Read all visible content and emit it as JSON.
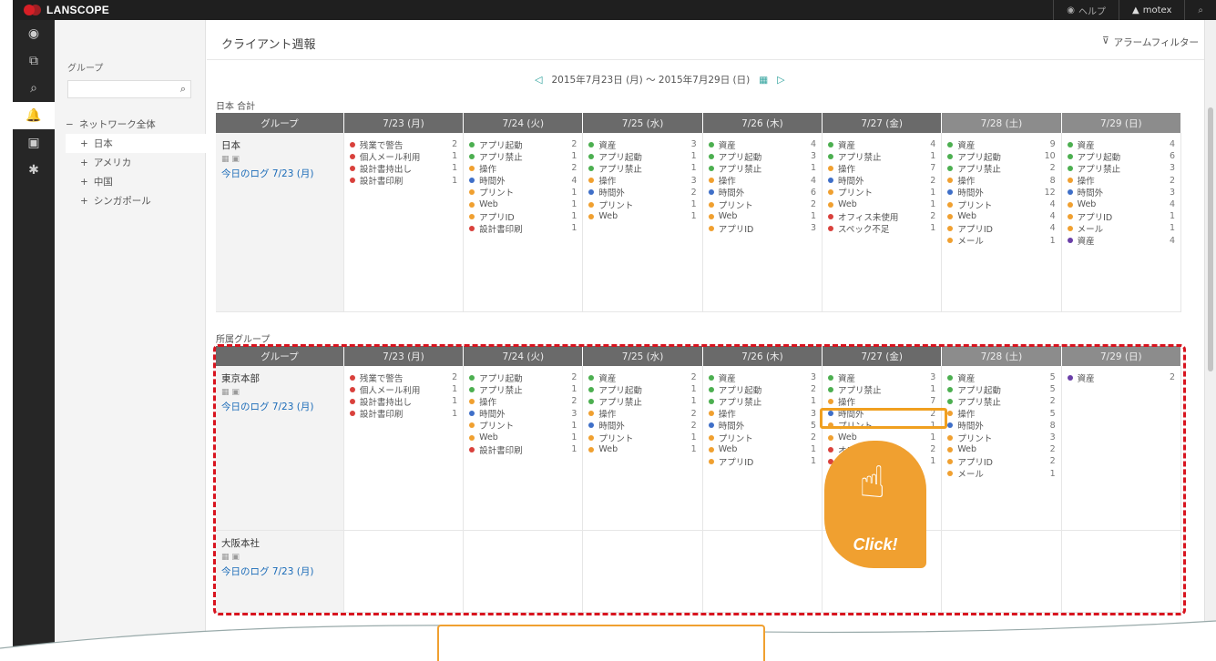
{
  "app": {
    "logo_text": "LANSCOPE"
  },
  "topbar": {
    "help_label": "ヘルプ",
    "user_label": "motex"
  },
  "nav": {
    "items": [
      {
        "icon": "dashboard-icon",
        "glyph": "◉"
      },
      {
        "icon": "devices-icon",
        "glyph": "⧉"
      },
      {
        "icon": "search-icon",
        "glyph": "⌕"
      },
      {
        "icon": "bell-icon",
        "glyph": "🔔",
        "active": true
      },
      {
        "icon": "report-icon",
        "glyph": "▣"
      },
      {
        "icon": "gear-icon",
        "glyph": "✱"
      }
    ]
  },
  "groups_panel": {
    "title": "グループ",
    "search_placeholder": "",
    "tree": [
      {
        "label": "ネットワーク全体",
        "prefix": "−",
        "level": 0
      },
      {
        "label": "日本",
        "prefix": "+",
        "level": 1,
        "selected": true
      },
      {
        "label": "アメリカ",
        "prefix": "+",
        "level": 1
      },
      {
        "label": "中国",
        "prefix": "+",
        "level": 1
      },
      {
        "label": "シンガポール",
        "prefix": "+",
        "level": 1
      }
    ]
  },
  "page": {
    "title": "クライアント週報",
    "alarm_filter_label": "アラームフィルター",
    "date_range": "2015年7月23日 (月) ～ 2015年7月29日 (日)"
  },
  "days": [
    "7/23 (月)",
    "7/24 (火)",
    "7/25 (水)",
    "7/26 (木)",
    "7/27 (金)",
    "7/28 (土)",
    "7/29 (日)"
  ],
  "group_header": "グループ",
  "section1": {
    "label": "日本 合計",
    "rows": [
      {
        "name": "日本",
        "log_label": "今日のログ",
        "log_date": "7/23 (月)",
        "days": [
          [
            {
              "c": "#d9413c",
              "t": "残業で警告",
              "n": "2"
            },
            {
              "c": "#d9413c",
              "t": "個人メール利用",
              "n": "1"
            },
            {
              "c": "#d9413c",
              "t": "設計書持出し",
              "n": "1"
            },
            {
              "c": "#d9413c",
              "t": "設計書印刷",
              "n": "1"
            }
          ],
          [
            {
              "c": "#4caf50",
              "t": "アプリ起動",
              "n": "2"
            },
            {
              "c": "#4caf50",
              "t": "アプリ禁止",
              "n": "1"
            },
            {
              "c": "#f0a030",
              "t": "操作",
              "n": "2"
            },
            {
              "c": "#3f6fc8",
              "t": "時間外",
              "n": "4"
            },
            {
              "c": "#f0a030",
              "t": "プリント",
              "n": "1"
            },
            {
              "c": "#f0a030",
              "t": "Web",
              "n": "1"
            },
            {
              "c": "#f0a030",
              "t": "アプリID",
              "n": "1"
            },
            {
              "c": "#d9413c",
              "t": "設計書印刷",
              "n": "1"
            }
          ],
          [
            {
              "c": "#4caf50",
              "t": "資産",
              "n": "3"
            },
            {
              "c": "#4caf50",
              "t": "アプリ起動",
              "n": "1"
            },
            {
              "c": "#4caf50",
              "t": "アプリ禁止",
              "n": "1"
            },
            {
              "c": "#f0a030",
              "t": "操作",
              "n": "3"
            },
            {
              "c": "#3f6fc8",
              "t": "時間外",
              "n": "2"
            },
            {
              "c": "#f0a030",
              "t": "プリント",
              "n": "1"
            },
            {
              "c": "#f0a030",
              "t": "Web",
              "n": "1"
            }
          ],
          [
            {
              "c": "#4caf50",
              "t": "資産",
              "n": "4"
            },
            {
              "c": "#4caf50",
              "t": "アプリ起動",
              "n": "3"
            },
            {
              "c": "#4caf50",
              "t": "アプリ禁止",
              "n": "1"
            },
            {
              "c": "#f0a030",
              "t": "操作",
              "n": "4"
            },
            {
              "c": "#3f6fc8",
              "t": "時間外",
              "n": "6"
            },
            {
              "c": "#f0a030",
              "t": "プリント",
              "n": "2"
            },
            {
              "c": "#f0a030",
              "t": "Web",
              "n": "1"
            },
            {
              "c": "#f0a030",
              "t": "アプリID",
              "n": "3"
            }
          ],
          [
            {
              "c": "#4caf50",
              "t": "資産",
              "n": "4"
            },
            {
              "c": "#4caf50",
              "t": "アプリ禁止",
              "n": "1"
            },
            {
              "c": "#f0a030",
              "t": "操作",
              "n": "7"
            },
            {
              "c": "#3f6fc8",
              "t": "時間外",
              "n": "2"
            },
            {
              "c": "#f0a030",
              "t": "プリント",
              "n": "1"
            },
            {
              "c": "#f0a030",
              "t": "Web",
              "n": "1"
            },
            {
              "c": "#d9413c",
              "t": "オフィス未使用",
              "n": "2"
            },
            {
              "c": "#d9413c",
              "t": "スペック不足",
              "n": "1"
            }
          ],
          [
            {
              "c": "#4caf50",
              "t": "資産",
              "n": "9"
            },
            {
              "c": "#4caf50",
              "t": "アプリ起動",
              "n": "10"
            },
            {
              "c": "#4caf50",
              "t": "アプリ禁止",
              "n": "2"
            },
            {
              "c": "#f0a030",
              "t": "操作",
              "n": "8"
            },
            {
              "c": "#3f6fc8",
              "t": "時間外",
              "n": "12"
            },
            {
              "c": "#f0a030",
              "t": "プリント",
              "n": "4"
            },
            {
              "c": "#f0a030",
              "t": "Web",
              "n": "4"
            },
            {
              "c": "#f0a030",
              "t": "アプリID",
              "n": "4"
            },
            {
              "c": "#f0a030",
              "t": "メール",
              "n": "1"
            }
          ],
          [
            {
              "c": "#4caf50",
              "t": "資産",
              "n": "4"
            },
            {
              "c": "#4caf50",
              "t": "アプリ起動",
              "n": "6"
            },
            {
              "c": "#4caf50",
              "t": "アプリ禁止",
              "n": "3"
            },
            {
              "c": "#f0a030",
              "t": "操作",
              "n": "2"
            },
            {
              "c": "#3f6fc8",
              "t": "時間外",
              "n": "3"
            },
            {
              "c": "#f0a030",
              "t": "Web",
              "n": "4"
            },
            {
              "c": "#f0a030",
              "t": "アプリID",
              "n": "1"
            },
            {
              "c": "#f0a030",
              "t": "メール",
              "n": "1"
            },
            {
              "c": "#6a3fa8",
              "t": "資産",
              "n": "4"
            }
          ]
        ]
      }
    ]
  },
  "section2": {
    "label": "所属グループ",
    "rows": [
      {
        "name": "東京本部",
        "log_label": "今日のログ",
        "log_date": "7/23 (月)",
        "days": [
          [
            {
              "c": "#d9413c",
              "t": "残業で警告",
              "n": "2"
            },
            {
              "c": "#d9413c",
              "t": "個人メール利用",
              "n": "1"
            },
            {
              "c": "#d9413c",
              "t": "設計書持出し",
              "n": "1"
            },
            {
              "c": "#d9413c",
              "t": "設計書印刷",
              "n": "1"
            }
          ],
          [
            {
              "c": "#4caf50",
              "t": "アプリ起動",
              "n": "2"
            },
            {
              "c": "#4caf50",
              "t": "アプリ禁止",
              "n": "1"
            },
            {
              "c": "#f0a030",
              "t": "操作",
              "n": "2"
            },
            {
              "c": "#3f6fc8",
              "t": "時間外",
              "n": "3"
            },
            {
              "c": "#f0a030",
              "t": "プリント",
              "n": "1"
            },
            {
              "c": "#f0a030",
              "t": "Web",
              "n": "1"
            },
            {
              "c": "#d9413c",
              "t": "設計書印刷",
              "n": "1"
            }
          ],
          [
            {
              "c": "#4caf50",
              "t": "資産",
              "n": "2"
            },
            {
              "c": "#4caf50",
              "t": "アプリ起動",
              "n": "1"
            },
            {
              "c": "#4caf50",
              "t": "アプリ禁止",
              "n": "1"
            },
            {
              "c": "#f0a030",
              "t": "操作",
              "n": "2"
            },
            {
              "c": "#3f6fc8",
              "t": "時間外",
              "n": "2"
            },
            {
              "c": "#f0a030",
              "t": "プリント",
              "n": "1"
            },
            {
              "c": "#f0a030",
              "t": "Web",
              "n": "1"
            }
          ],
          [
            {
              "c": "#4caf50",
              "t": "資産",
              "n": "3"
            },
            {
              "c": "#4caf50",
              "t": "アプリ起動",
              "n": "2"
            },
            {
              "c": "#4caf50",
              "t": "アプリ禁止",
              "n": "1"
            },
            {
              "c": "#f0a030",
              "t": "操作",
              "n": "3"
            },
            {
              "c": "#3f6fc8",
              "t": "時間外",
              "n": "5"
            },
            {
              "c": "#f0a030",
              "t": "プリント",
              "n": "2"
            },
            {
              "c": "#f0a030",
              "t": "Web",
              "n": "1"
            },
            {
              "c": "#f0a030",
              "t": "アプリID",
              "n": "1"
            }
          ],
          [
            {
              "c": "#4caf50",
              "t": "資産",
              "n": "3"
            },
            {
              "c": "#4caf50",
              "t": "アプリ禁止",
              "n": "1"
            },
            {
              "c": "#f0a030",
              "t": "操作",
              "n": "7"
            },
            {
              "c": "#3f6fc8",
              "t": "時間外",
              "n": "2"
            },
            {
              "c": "#f0a030",
              "t": "プリント",
              "n": "1"
            },
            {
              "c": "#f0a030",
              "t": "Web",
              "n": "1"
            },
            {
              "c": "#d9413c",
              "t": "オフィス未使用",
              "n": "2"
            },
            {
              "c": "#d9413c",
              "t": "スペック不足",
              "n": "1"
            }
          ],
          [
            {
              "c": "#4caf50",
              "t": "資産",
              "n": "5"
            },
            {
              "c": "#4caf50",
              "t": "アプリ起動",
              "n": "5"
            },
            {
              "c": "#4caf50",
              "t": "アプリ禁止",
              "n": "2"
            },
            {
              "c": "#f0a030",
              "t": "操作",
              "n": "5"
            },
            {
              "c": "#3f6fc8",
              "t": "時間外",
              "n": "8"
            },
            {
              "c": "#f0a030",
              "t": "プリント",
              "n": "3"
            },
            {
              "c": "#f0a030",
              "t": "Web",
              "n": "2"
            },
            {
              "c": "#f0a030",
              "t": "アプリID",
              "n": "2"
            },
            {
              "c": "#f0a030",
              "t": "メール",
              "n": "1"
            }
          ],
          [
            {
              "c": "#6a3fa8",
              "t": "資産",
              "n": "2"
            }
          ]
        ]
      },
      {
        "name": "大阪本社",
        "log_label": "今日のログ",
        "log_date": "7/23 (月)",
        "days": [
          [],
          [],
          [],
          [],
          [],
          [],
          []
        ]
      }
    ]
  },
  "callout": {
    "click_text": "Click!"
  }
}
